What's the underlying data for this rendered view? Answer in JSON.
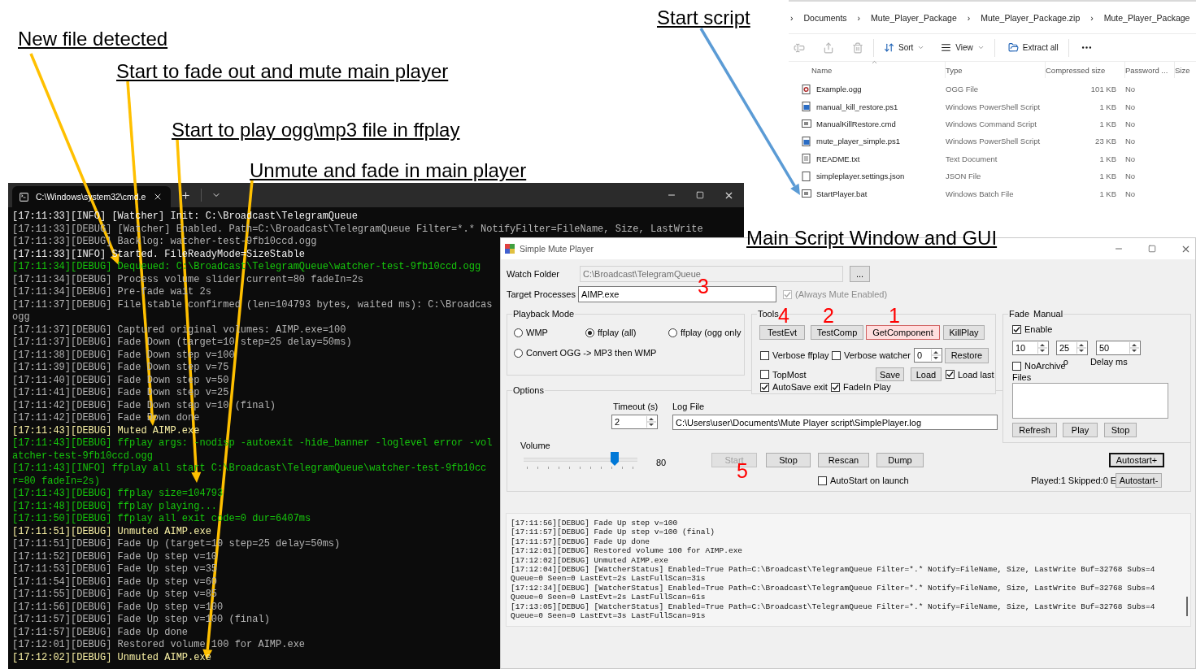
{
  "annotations": [
    {
      "text": "New file detected"
    },
    {
      "text": "Start to fade out and mute main player"
    },
    {
      "text": "Start to play ogg\\mp3 file in ffplay"
    },
    {
      "text": "Unmute and fade in main player"
    },
    {
      "text": "Start script"
    },
    {
      "text": "Main Script Window and GUI"
    }
  ],
  "step_markers": [
    "3",
    "4",
    "2",
    "1",
    "5"
  ],
  "explorer": {
    "separator": "›",
    "breadcrumb": [
      "Documents",
      "Mute_Player_Package",
      "Mute_Player_Package.zip",
      "Mute_Player_Package"
    ],
    "toolbar": [
      "Sort",
      "View",
      "Extract all"
    ],
    "columns": [
      "Name",
      "Type",
      "Compressed size",
      "Password ...",
      "Size"
    ],
    "files": [
      {
        "kind": "audio",
        "name": "Example.ogg",
        "type": "OGG File",
        "compressed_size": "101 KB",
        "password": "No"
      },
      {
        "kind": "powershell",
        "name": "manual_kill_restore.ps1",
        "type": "Windows PowerShell Script",
        "compressed_size": "1 KB",
        "password": "No"
      },
      {
        "kind": "command",
        "name": "ManualKillRestore.cmd",
        "type": "Windows Command Script",
        "compressed_size": "1 KB",
        "password": "No"
      },
      {
        "kind": "powershell",
        "name": "mute_player_simple.ps1",
        "type": "Windows PowerShell Script",
        "compressed_size": "23 KB",
        "password": "No"
      },
      {
        "kind": "text",
        "name": "README.txt",
        "type": "Text Document",
        "compressed_size": "1 KB",
        "password": "No"
      },
      {
        "kind": "json",
        "name": "simpleplayer.settings.json",
        "type": "JSON File",
        "compressed_size": "1 KB",
        "password": "No"
      },
      {
        "kind": "command",
        "name": "StartPlayer.bat",
        "type": "Windows Batch File",
        "compressed_size": "1 KB",
        "password": "No"
      }
    ]
  },
  "console": {
    "tab_title": "C:\\Windows\\system32\\cmd.e",
    "lines": [
      {
        "kind": "info",
        "text": "[17:11:33][INFO] [Watcher] Init: C:\\Broadcast\\TelegramQueue"
      },
      {
        "kind": "debug",
        "text": "[17:11:33][DEBUG] [Watcher] Enabled. Path=C:\\Broadcast\\TelegramQueue Filter=*.* NotifyFilter=FileName, Size, LastWrite"
      },
      {
        "kind": "debug",
        "text": "[17:11:33][DEBUG] Backlog: watcher-test-9fb10ccd.ogg"
      },
      {
        "kind": "info",
        "text": "[17:11:33][INFO] Started. FileReadyMode=SizeStable"
      },
      {
        "kind": "green",
        "text": "[17:11:34][DEBUG] Dequeued: C:\\Broadcast\\TelegramQueue\\watcher-test-9fb10ccd.ogg"
      },
      {
        "kind": "debug",
        "text": "[17:11:34][DEBUG] Process volume slider current=80 fadeIn=2s"
      },
      {
        "kind": "debug",
        "text": "[17:11:34][DEBUG] Pre-fade wait 2s"
      },
      {
        "kind": "debug",
        "text": "[17:11:37][DEBUG] File stable confirmed (len=104793 bytes, waited ms): C:\\Broadcas"
      },
      {
        "kind": "debug",
        "text": "ogg"
      },
      {
        "kind": "debug",
        "text": "[17:11:37][DEBUG] Captured original volumes: AIMP.exe=100"
      },
      {
        "kind": "debug",
        "text": "[17:11:37][DEBUG] Fade Down (target=10 step=25 delay=50ms)"
      },
      {
        "kind": "debug",
        "text": "[17:11:38][DEBUG] Fade Down step v=100"
      },
      {
        "kind": "debug",
        "text": "[17:11:39][DEBUG] Fade Down step v=75"
      },
      {
        "kind": "debug",
        "text": "[17:11:40][DEBUG] Fade Down step v=50"
      },
      {
        "kind": "debug",
        "text": "[17:11:41][DEBUG] Fade Down step v=25"
      },
      {
        "kind": "debug",
        "text": "[17:11:42][DEBUG] Fade Down step v=10 (final)"
      },
      {
        "kind": "debug",
        "text": "[17:11:42][DEBUG] Fade Down done"
      },
      {
        "kind": "yellow",
        "text": "[17:11:43][DEBUG] Muted AIMP.exe"
      },
      {
        "kind": "green",
        "text": "[17:11:43][DEBUG] ffplay args: -nodisp -autoexit -hide_banner -loglevel error -vol"
      },
      {
        "kind": "green",
        "text": "atcher-test-9fb10ccd.ogg"
      },
      {
        "kind": "green",
        "text": "[17:11:43][INFO] ffplay all start C:\\Broadcast\\TelegramQueue\\watcher-test-9fb10cc"
      },
      {
        "kind": "green",
        "text": "r=80 fadeIn=2s)"
      },
      {
        "kind": "green",
        "text": "[17:11:43][DEBUG] ffplay size=104793"
      },
      {
        "kind": "green",
        "text": "[17:11:48][DEBUG] ffplay playing..."
      },
      {
        "kind": "green",
        "text": "[17:11:50][DEBUG] ffplay all exit code=0 dur=6407ms"
      },
      {
        "kind": "yellow",
        "text": "[17:11:51][DEBUG] Unmuted AIMP.exe"
      },
      {
        "kind": "debug",
        "text": "[17:11:51][DEBUG] Fade Up (target=10 step=25 delay=50ms)"
      },
      {
        "kind": "debug",
        "text": "[17:11:52][DEBUG] Fade Up step v=10"
      },
      {
        "kind": "debug",
        "text": "[17:11:53][DEBUG] Fade Up step v=35"
      },
      {
        "kind": "debug",
        "text": "[17:11:54][DEBUG] Fade Up step v=60"
      },
      {
        "kind": "debug",
        "text": "[17:11:55][DEBUG] Fade Up step v=85"
      },
      {
        "kind": "debug",
        "text": "[17:11:56][DEBUG] Fade Up step v=100"
      },
      {
        "kind": "debug",
        "text": "[17:11:57][DEBUG] Fade Up step v=100 (final)"
      },
      {
        "kind": "debug",
        "text": "[17:11:57][DEBUG] Fade Up done"
      },
      {
        "kind": "debug",
        "text": "[17:12:01][DEBUG] Restored volume 100 for AIMP.exe"
      },
      {
        "kind": "yellow",
        "text": "[17:12:02][DEBUG] Unmuted AIMP.exe"
      }
    ]
  },
  "gui": {
    "title": "Simple Mute Player",
    "watch_folder": {
      "label": "Watch Folder",
      "value": "C:\\Broadcast\\TelegramQueue",
      "disabled": true,
      "browse": "..."
    },
    "target_processes": {
      "label": "Target Processes",
      "value": "AIMP.exe"
    },
    "always_mute": {
      "label": "(Always Mute Enabled)",
      "checked": true,
      "disabled": true
    },
    "playback_mode": {
      "title": "Playback Mode",
      "options": [
        {
          "label": "WMP",
          "selected": false
        },
        {
          "label": "ffplay (all)",
          "selected": true
        },
        {
          "label": "ffplay (ogg only",
          "selected": false
        },
        {
          "label": "Convert OGG -> MP3 then WMP",
          "selected": false
        }
      ]
    },
    "tools": {
      "title": "Tools",
      "buttons": [
        {
          "label": "TestEvt",
          "highlighted": false
        },
        {
          "label": "TestComp",
          "highlighted": false
        },
        {
          "label": "GetComponent",
          "highlighted": true
        },
        {
          "label": "KillPlay",
          "highlighted": false
        }
      ],
      "verbose_ffplay": {
        "label": "Verbose ffplay",
        "checked": false
      },
      "verbose_watcher": {
        "label": "Verbose watcher",
        "checked": false
      },
      "verbose_level": "0",
      "restore": "Restore",
      "topmost": {
        "label": "TopMost",
        "checked": false
      },
      "save": "Save",
      "load": "Load",
      "load_last": {
        "label": "Load last",
        "checked": true
      },
      "autosave_exit": {
        "label": "AutoSave exit",
        "checked": true
      },
      "fadein_play": {
        "label": "FadeIn Play",
        "checked": true
      }
    },
    "fade": {
      "title": "Fade",
      "mode": "Manual",
      "enable": {
        "label": "Enable",
        "checked": true
      },
      "spinners": [
        "10",
        "25",
        "50"
      ],
      "no_archive": {
        "label": "NoArchive",
        "checked": false
      },
      "cut_label": "o",
      "delay_label": "Delay ms",
      "files_label": "Files",
      "buttons": [
        "Refresh",
        "Play",
        "Stop"
      ]
    },
    "options": {
      "title": "Options",
      "timeout_label": "Timeout (s)",
      "timeout": "2",
      "log_file_label": "Log File",
      "log_file": "C:\\Users\\user\\Documents\\Mute Player script\\SimplePlayer.log",
      "volume_label": "Volume",
      "volume": {
        "level": 0.8,
        "reading": "80"
      },
      "buttons": [
        {
          "label": "Start",
          "disabled": true
        },
        {
          "label": "Stop",
          "disabled": false
        },
        {
          "label": "Rescan",
          "disabled": false
        },
        {
          "label": "Dump",
          "disabled": false
        }
      ],
      "autostart_plus": {
        "label": "Autostart+",
        "default": true
      },
      "autostart_on_launch": {
        "label": "AutoStart on launch",
        "checked": false
      },
      "stats": "Played:1 Skipped:0 E",
      "autostart_minus": {
        "label": "Autostart-",
        "default": false
      }
    },
    "log": [
      "[17:11:56][DEBUG] Fade Up step v=100",
      "[17:11:57][DEBUG] Fade Up step v=100 (final)",
      "[17:11:57][DEBUG] Fade Up done",
      "[17:12:01][DEBUG] Restored volume 100 for AIMP.exe",
      "[17:12:02][DEBUG] Unmuted AIMP.exe",
      "[17:12:04][DEBUG] [WatcherStatus] Enabled=True Path=C:\\Broadcast\\TelegramQueue Filter=*.* Notify=FileName, Size, LastWrite Buf=32768 Subs=4",
      "Queue=0 Seen=0 LastEvt=2s LastFullScan=31s",
      "[17:12:34][DEBUG] [WatcherStatus] Enabled=True Path=C:\\Broadcast\\TelegramQueue Filter=*.* Notify=FileName, Size, LastWrite Buf=32768 Subs=4",
      "Queue=0 Seen=0 LastEvt=2s LastFullScan=61s",
      "[17:13:05][DEBUG] [WatcherStatus] Enabled=True Path=C:\\Broadcast\\TelegramQueue Filter=*.* Notify=FileName, Size, LastWrite Buf=32768 Subs=4",
      "Queue=0 Seen=0 LastEvt=3s LastFullScan=91s"
    ]
  }
}
